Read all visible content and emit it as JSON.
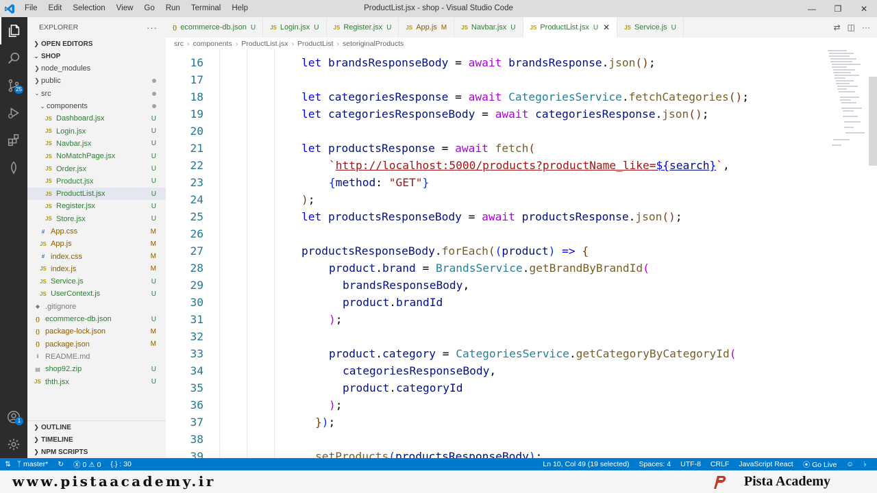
{
  "window": {
    "title": "ProductList.jsx - shop - Visual Studio Code",
    "menu": [
      "File",
      "Edit",
      "Selection",
      "View",
      "Go",
      "Run",
      "Terminal",
      "Help"
    ]
  },
  "activity": {
    "source_control_badge": "25",
    "accounts_badge": "1"
  },
  "sidebar": {
    "title": "EXPLORER",
    "open_editors": "OPEN EDITORS",
    "folder": "SHOP",
    "tree": [
      {
        "label": "node_modules",
        "type": "folder",
        "level": 1,
        "open": false,
        "deco": ""
      },
      {
        "label": "public",
        "type": "folder",
        "level": 1,
        "open": false,
        "deco": "dot"
      },
      {
        "label": "src",
        "type": "folder",
        "level": 1,
        "open": true,
        "deco": "dot"
      },
      {
        "label": "components",
        "type": "folder",
        "level": 2,
        "open": true,
        "deco": "dot"
      },
      {
        "label": "Dashboard.jsx",
        "type": "file",
        "icon": "JS",
        "level": 3,
        "deco": "U"
      },
      {
        "label": "Login.jsx",
        "type": "file",
        "icon": "JS",
        "level": 3,
        "deco": "U"
      },
      {
        "label": "Navbar.jsx",
        "type": "file",
        "icon": "JS",
        "level": 3,
        "deco": "U"
      },
      {
        "label": "NoMatchPage.jsx",
        "type": "file",
        "icon": "JS",
        "level": 3,
        "deco": "U"
      },
      {
        "label": "Order.jsx",
        "type": "file",
        "icon": "JS",
        "level": 3,
        "deco": "U"
      },
      {
        "label": "Product.jsx",
        "type": "file",
        "icon": "JS",
        "level": 3,
        "deco": "U"
      },
      {
        "label": "ProductList.jsx",
        "type": "file",
        "icon": "JS",
        "level": 3,
        "deco": "U",
        "selected": true
      },
      {
        "label": "Register.jsx",
        "type": "file",
        "icon": "JS",
        "level": 3,
        "deco": "U"
      },
      {
        "label": "Store.jsx",
        "type": "file",
        "icon": "JS",
        "level": 3,
        "deco": "U"
      },
      {
        "label": "App.css",
        "type": "file",
        "icon": "#",
        "level": 2,
        "deco": "M"
      },
      {
        "label": "App.js",
        "type": "file",
        "icon": "JS",
        "level": 2,
        "deco": "M"
      },
      {
        "label": "index.css",
        "type": "file",
        "icon": "#",
        "level": 2,
        "deco": "M"
      },
      {
        "label": "index.js",
        "type": "file",
        "icon": "JS",
        "level": 2,
        "deco": "M"
      },
      {
        "label": "Service.js",
        "type": "file",
        "icon": "JS",
        "level": 2,
        "deco": "U"
      },
      {
        "label": "UserContext.js",
        "type": "file",
        "icon": "JS",
        "level": 2,
        "deco": "U"
      },
      {
        "label": ".gitignore",
        "type": "file",
        "icon": "◆",
        "level": 1,
        "deco": ""
      },
      {
        "label": "ecommerce-db.json",
        "type": "file",
        "icon": "{}",
        "level": 1,
        "deco": "U"
      },
      {
        "label": "package-lock.json",
        "type": "file",
        "icon": "{}",
        "level": 1,
        "deco": "M"
      },
      {
        "label": "package.json",
        "type": "file",
        "icon": "{}",
        "level": 1,
        "deco": "M"
      },
      {
        "label": "README.md",
        "type": "file",
        "icon": "i",
        "level": 1,
        "deco": ""
      },
      {
        "label": "shop92.zip",
        "type": "file",
        "icon": "▤",
        "level": 1,
        "deco": "U"
      },
      {
        "label": "thth.jsx",
        "type": "file",
        "icon": "JS",
        "level": 1,
        "deco": "U"
      }
    ],
    "outline": "OUTLINE",
    "timeline": "TIMELINE",
    "npm_scripts": "NPM SCRIPTS"
  },
  "tabs": [
    {
      "label": "ecommerce-db.json",
      "icon": "{}",
      "state": "U",
      "active": false
    },
    {
      "label": "Login.jsx",
      "icon": "JS",
      "state": "U",
      "active": false
    },
    {
      "label": "Register.jsx",
      "icon": "JS",
      "state": "U",
      "active": false
    },
    {
      "label": "App.js",
      "icon": "JS",
      "state": "M",
      "active": false
    },
    {
      "label": "Navbar.jsx",
      "icon": "JS",
      "state": "U",
      "active": false
    },
    {
      "label": "ProductList.jsx",
      "icon": "JS",
      "state": "U",
      "active": true
    },
    {
      "label": "Service.js",
      "icon": "JS",
      "state": "U",
      "active": false
    }
  ],
  "breadcrumb": [
    "src",
    "components",
    "ProductList.jsx",
    "ProductList",
    "setoriginalProducts"
  ],
  "editor": {
    "first_line": 16,
    "lines": [
      {
        "indent": 0,
        "tokens": [
          [
            "kw",
            "let "
          ],
          [
            "vr",
            "brandsResponseBody"
          ],
          [
            "pn",
            " = "
          ],
          [
            "ctl",
            "await "
          ],
          [
            "vr",
            "brandsResponse"
          ],
          [
            "pn",
            "."
          ],
          [
            "fn",
            "json"
          ],
          [
            "br3",
            "()"
          ],
          [
            "pn",
            ";"
          ]
        ]
      },
      {
        "indent": 0,
        "tokens": []
      },
      {
        "indent": 0,
        "tokens": [
          [
            "kw",
            "let "
          ],
          [
            "vr",
            "categoriesResponse"
          ],
          [
            "pn",
            " = "
          ],
          [
            "ctl",
            "await "
          ],
          [
            "cls",
            "CategoriesService"
          ],
          [
            "pn",
            "."
          ],
          [
            "fn",
            "fetchCategories"
          ],
          [
            "br3",
            "()"
          ],
          [
            "pn",
            ";"
          ]
        ]
      },
      {
        "indent": 0,
        "tokens": [
          [
            "kw",
            "let "
          ],
          [
            "vr",
            "categoriesResponseBody"
          ],
          [
            "pn",
            " = "
          ],
          [
            "ctl",
            "await "
          ],
          [
            "vr",
            "categoriesResponse"
          ],
          [
            "pn",
            "."
          ],
          [
            "fn",
            "json"
          ],
          [
            "br3",
            "()"
          ],
          [
            "pn",
            ";"
          ]
        ]
      },
      {
        "indent": 0,
        "tokens": []
      },
      {
        "indent": 0,
        "tokens": [
          [
            "kw",
            "let "
          ],
          [
            "vr",
            "productsResponse"
          ],
          [
            "pn",
            " = "
          ],
          [
            "ctl",
            "await "
          ],
          [
            "fn",
            "fetch"
          ],
          [
            "br3",
            "("
          ]
        ]
      },
      {
        "indent": 4,
        "tokens": [
          [
            "str",
            "`"
          ],
          [
            "str url",
            "http://localhost:5000/products?productName_like="
          ],
          [
            "kw url",
            "${"
          ],
          [
            "vr url",
            "search"
          ],
          [
            "kw url",
            "}"
          ],
          [
            "str",
            "`"
          ],
          [
            "pn",
            ","
          ]
        ]
      },
      {
        "indent": 4,
        "tokens": [
          [
            "br1",
            "{"
          ],
          [
            "vr",
            "method"
          ],
          [
            "pn",
            ": "
          ],
          [
            "str",
            "\"GET\""
          ],
          [
            "br1",
            "}"
          ]
        ]
      },
      {
        "indent": 0,
        "tokens": [
          [
            "br3",
            ")"
          ],
          [
            "pn",
            ";"
          ]
        ]
      },
      {
        "indent": 0,
        "tokens": [
          [
            "kw",
            "let "
          ],
          [
            "vr",
            "productsResponseBody"
          ],
          [
            "pn",
            " = "
          ],
          [
            "ctl",
            "await "
          ],
          [
            "vr",
            "productsResponse"
          ],
          [
            "pn",
            "."
          ],
          [
            "fn",
            "json"
          ],
          [
            "br3",
            "()"
          ],
          [
            "pn",
            ";"
          ]
        ]
      },
      {
        "indent": 0,
        "tokens": []
      },
      {
        "indent": 0,
        "tokens": [
          [
            "vr",
            "productsResponseBody"
          ],
          [
            "pn",
            "."
          ],
          [
            "fn",
            "forEach"
          ],
          [
            "br3",
            "("
          ],
          [
            "br1",
            "("
          ],
          [
            "vr",
            "product"
          ],
          [
            "br1",
            ")"
          ],
          [
            "kw",
            " => "
          ],
          [
            "br3",
            "{"
          ]
        ]
      },
      {
        "indent": 4,
        "tokens": [
          [
            "vr",
            "product"
          ],
          [
            "pn",
            "."
          ],
          [
            "vr",
            "brand"
          ],
          [
            "pn",
            " = "
          ],
          [
            "cls",
            "BrandsService"
          ],
          [
            "pn",
            "."
          ],
          [
            "fn",
            "getBrandByBrandId"
          ],
          [
            "ctl",
            "("
          ]
        ]
      },
      {
        "indent": 6,
        "tokens": [
          [
            "vr",
            "brandsResponseBody"
          ],
          [
            "pn",
            ","
          ]
        ]
      },
      {
        "indent": 6,
        "tokens": [
          [
            "vr",
            "product"
          ],
          [
            "pn",
            "."
          ],
          [
            "vr",
            "brandId"
          ]
        ]
      },
      {
        "indent": 4,
        "tokens": [
          [
            "ctl",
            ")"
          ],
          [
            "pn",
            ";"
          ]
        ]
      },
      {
        "indent": 0,
        "tokens": []
      },
      {
        "indent": 4,
        "tokens": [
          [
            "vr",
            "product"
          ],
          [
            "pn",
            "."
          ],
          [
            "vr",
            "category"
          ],
          [
            "pn",
            " = "
          ],
          [
            "cls",
            "CategoriesService"
          ],
          [
            "pn",
            "."
          ],
          [
            "fn",
            "getCategoryByCategoryId"
          ],
          [
            "ctl",
            "("
          ]
        ]
      },
      {
        "indent": 6,
        "tokens": [
          [
            "vr",
            "categoriesResponseBody"
          ],
          [
            "pn",
            ","
          ]
        ]
      },
      {
        "indent": 6,
        "tokens": [
          [
            "vr",
            "product"
          ],
          [
            "pn",
            "."
          ],
          [
            "vr",
            "categoryId"
          ]
        ]
      },
      {
        "indent": 4,
        "tokens": [
          [
            "ctl",
            ")"
          ],
          [
            "pn",
            ";"
          ]
        ]
      },
      {
        "indent": 2,
        "tokens": [
          [
            "br3",
            "}"
          ],
          [
            "br1",
            ")"
          ],
          [
            "pn",
            ";"
          ]
        ]
      },
      {
        "indent": 0,
        "tokens": []
      },
      {
        "indent": 2,
        "tokens": [
          [
            "fn",
            "setProducts"
          ],
          [
            "br1",
            "("
          ],
          [
            "vr",
            "productsResponseBody"
          ],
          [
            "br1",
            ")"
          ],
          [
            "pn",
            ";"
          ]
        ]
      }
    ]
  },
  "statusbar": {
    "branch": "master*",
    "errors": "0",
    "warnings": "0",
    "selection": "{.} : 30",
    "position": "Ln 10, Col 49 (19 selected)",
    "spaces": "Spaces: 4",
    "encoding": "UTF-8",
    "eol": "CRLF",
    "language": "JavaScript React",
    "golive": "Go Live"
  },
  "banner": {
    "site": "www.pistaacademy.ir",
    "brand": "Pista Academy"
  },
  "colors": {
    "statusbar": "#007acc",
    "activitybar": "#2c2c2c",
    "sidebar": "#f3f3f3",
    "banner_logo": "#c0392b"
  }
}
